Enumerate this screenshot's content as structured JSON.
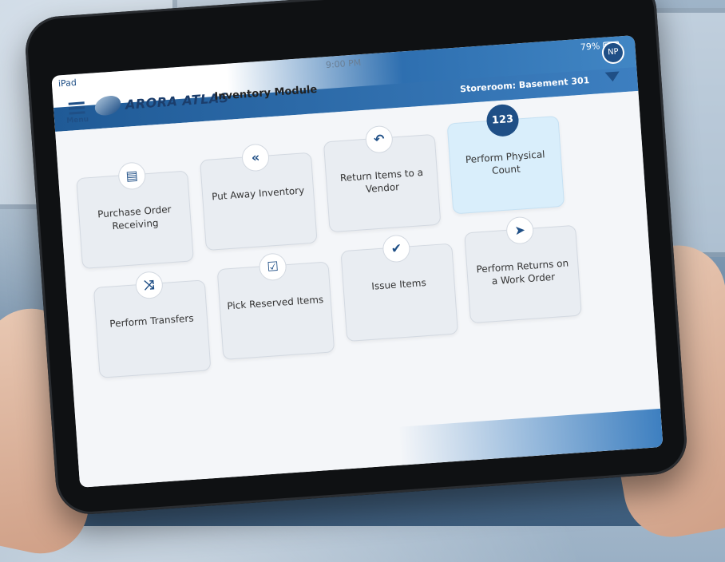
{
  "device": {
    "label": "iPad",
    "time": "9:00 PM",
    "battery": "79%"
  },
  "header": {
    "menu_label": "Menu",
    "brand": "ARORA ATLAS",
    "module_title": "Inventory Module",
    "storeroom": "Storeroom:  Basement 301",
    "user_initials": "NP"
  },
  "tiles": [
    {
      "label": "Purchase Order Receiving",
      "icon": "document-icon",
      "glyph": "▤"
    },
    {
      "label": "Put Away Inventory",
      "icon": "double-arrow-back-icon",
      "glyph": "«"
    },
    {
      "label": "Return Items to a Vendor",
      "icon": "return-arrow-icon",
      "glyph": "↶"
    },
    {
      "label": "Perform Physical Count",
      "icon": "count-123-icon",
      "glyph": "123"
    },
    {
      "label": "Perform Transfers",
      "icon": "shuffle-icon",
      "glyph": "⤨"
    },
    {
      "label": "Pick Reserved Items",
      "icon": "clipboard-check-icon",
      "glyph": "☑"
    },
    {
      "label": "Issue Items",
      "icon": "checkmark-icon",
      "glyph": "✔"
    },
    {
      "label": "Perform Returns on a Work Order",
      "icon": "send-icon",
      "glyph": "➤"
    }
  ],
  "colors": {
    "accent": "#1f4f86",
    "header_blue": "#3d7fc0",
    "active_tile": "#d9eefb"
  }
}
